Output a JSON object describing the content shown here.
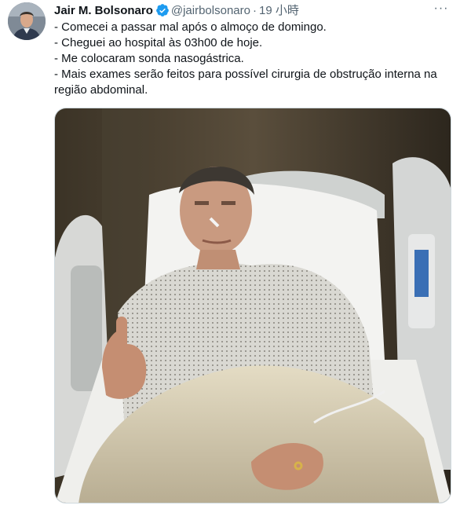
{
  "author": {
    "name": "Jair M. Bolsonaro",
    "handle": "@jairbolsonaro",
    "separator": "·",
    "time": "19 小時",
    "verified_icon": "verified-badge-icon"
  },
  "menu": {
    "more_icon": "more-horizontal-icon",
    "more_label": "···"
  },
  "tweet": {
    "lines": [
      "- Comecei a passar mal após o almoço de domingo.",
      "- Cheguei ao hospital às 03h00 de hoje.",
      "- Me colocaram sonda nasogástrica.",
      "- Mais exames serão feitos para possível cirurgia de obstrução interna na região abdominal."
    ]
  },
  "colors": {
    "text": "#0f1419",
    "secondary": "#536471",
    "verified": "#1d9bf0",
    "border": "#cfd9de"
  }
}
